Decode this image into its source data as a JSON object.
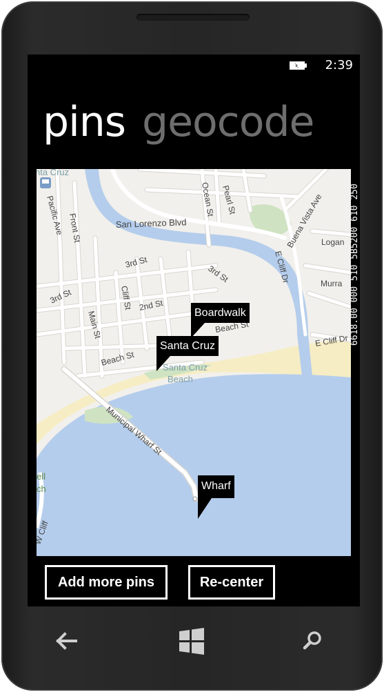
{
  "status_bar": {
    "time": "2:39",
    "battery_icon": "charging-battery-icon"
  },
  "pivot": {
    "active_label": "pins",
    "inactive_label": "geocode"
  },
  "debug_counters": "6618.00 000 510 5B5200 610 250",
  "map": {
    "street_labels": {
      "ocean": "Ocean St",
      "pearl": "Pearl St",
      "buena_vista": "Buena Vista Ave",
      "logan": "Logan",
      "murray": "Murra",
      "pacific": "Pacific Ave",
      "front": "Front St",
      "san_lorenzo": "San Lorenzo Blvd",
      "third_a": "3rd St",
      "third_b": "3rd St",
      "third_c": "3rd St",
      "cliff": "Cliff St",
      "second": "2nd St",
      "main": "Main St",
      "beach": "Beach St",
      "beach_2": "Beach St",
      "e_cliff": "E Cliff Dr",
      "e_cliff_2": "E Cliff Dr",
      "wharf": "Municipal Wharf St",
      "w_cliff": "W Cliff",
      "ell": "ell",
      "ch": "ch"
    },
    "place_labels": {
      "santa_cruz_top": "nta Cruz",
      "beach_area_1": "Santa Cruz",
      "beach_area_2": "Beach"
    },
    "colors": {
      "land": "#f2f0ec",
      "water": "#b5cdec",
      "sand": "#f6edc4",
      "park": "#cfe3c2",
      "road": "#ffffff",
      "road_edge": "#d8d6d0"
    }
  },
  "pins": [
    {
      "label": "Boardwalk"
    },
    {
      "label": "Santa Cruz"
    },
    {
      "label": "Wharf"
    }
  ],
  "buttons": {
    "add_more_pins": "Add more pins",
    "recenter": "Re-center"
  },
  "nav": {
    "back": "back-arrow-icon",
    "start": "windows-start-icon",
    "search": "search-icon"
  }
}
